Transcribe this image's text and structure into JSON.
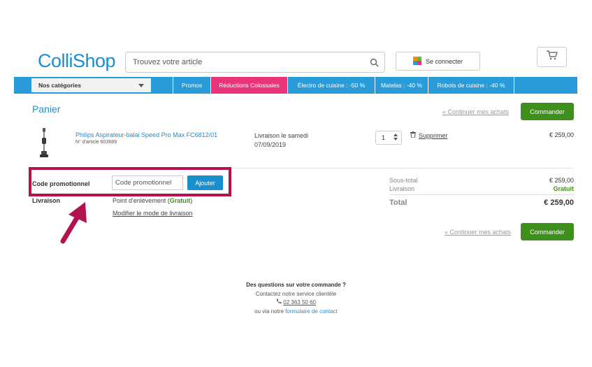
{
  "header": {
    "logo": "ColliShop",
    "search_placeholder": "Trouvez votre article",
    "login_label": "Se connecter"
  },
  "nav": {
    "categories": "Nos catégories",
    "items": [
      {
        "label": "Promos"
      },
      {
        "label": "Réductions Colossales"
      },
      {
        "label": "Électro de cuisine : -50 %"
      },
      {
        "label": "Matelas : -40 %"
      },
      {
        "label": "Robots de cuisine : -40 %"
      }
    ]
  },
  "cart": {
    "title": "Panier",
    "continue_label": "« Continuer mes achats",
    "order_label": "Commander",
    "product": {
      "name": "Philips Aspirateur-balai Speed Pro Max FC6812/01",
      "ref": "N° d'article 603689",
      "delivery_line1": "Livraison le samedi",
      "delivery_line2": "07/09/2019",
      "qty": "1",
      "delete_label": "Supprimer",
      "price": "€ 259,00"
    },
    "promo": {
      "label": "Code promotionnel",
      "placeholder": "Code promotionnel",
      "button": "Ajouter"
    },
    "delivery": {
      "label": "Livraison",
      "value": "Point d'enlèvement (",
      "free": "Gratuit",
      "close": ")",
      "modify": "Modifier le mode de livraison"
    },
    "summary": {
      "subtotal_label": "Sous-total",
      "subtotal_value": "€ 259,00",
      "delivery_label": "Livraison",
      "delivery_value": "Gratuit",
      "total_label": "Total",
      "total_value": "€ 259,00"
    }
  },
  "footer": {
    "question": "Des questions sur votre commande ?",
    "contact_service": "Contactez notre service clientèle",
    "phone": "02 363 50 60",
    "via": "ou via notre ",
    "contact_form": "formulaire de contact"
  },
  "colors": {
    "brand_blue": "#1a8fd0",
    "nav_blue": "#2a9bd9",
    "pink": "#e8347a",
    "green": "#3f8f1d",
    "highlight": "#b3124e"
  }
}
